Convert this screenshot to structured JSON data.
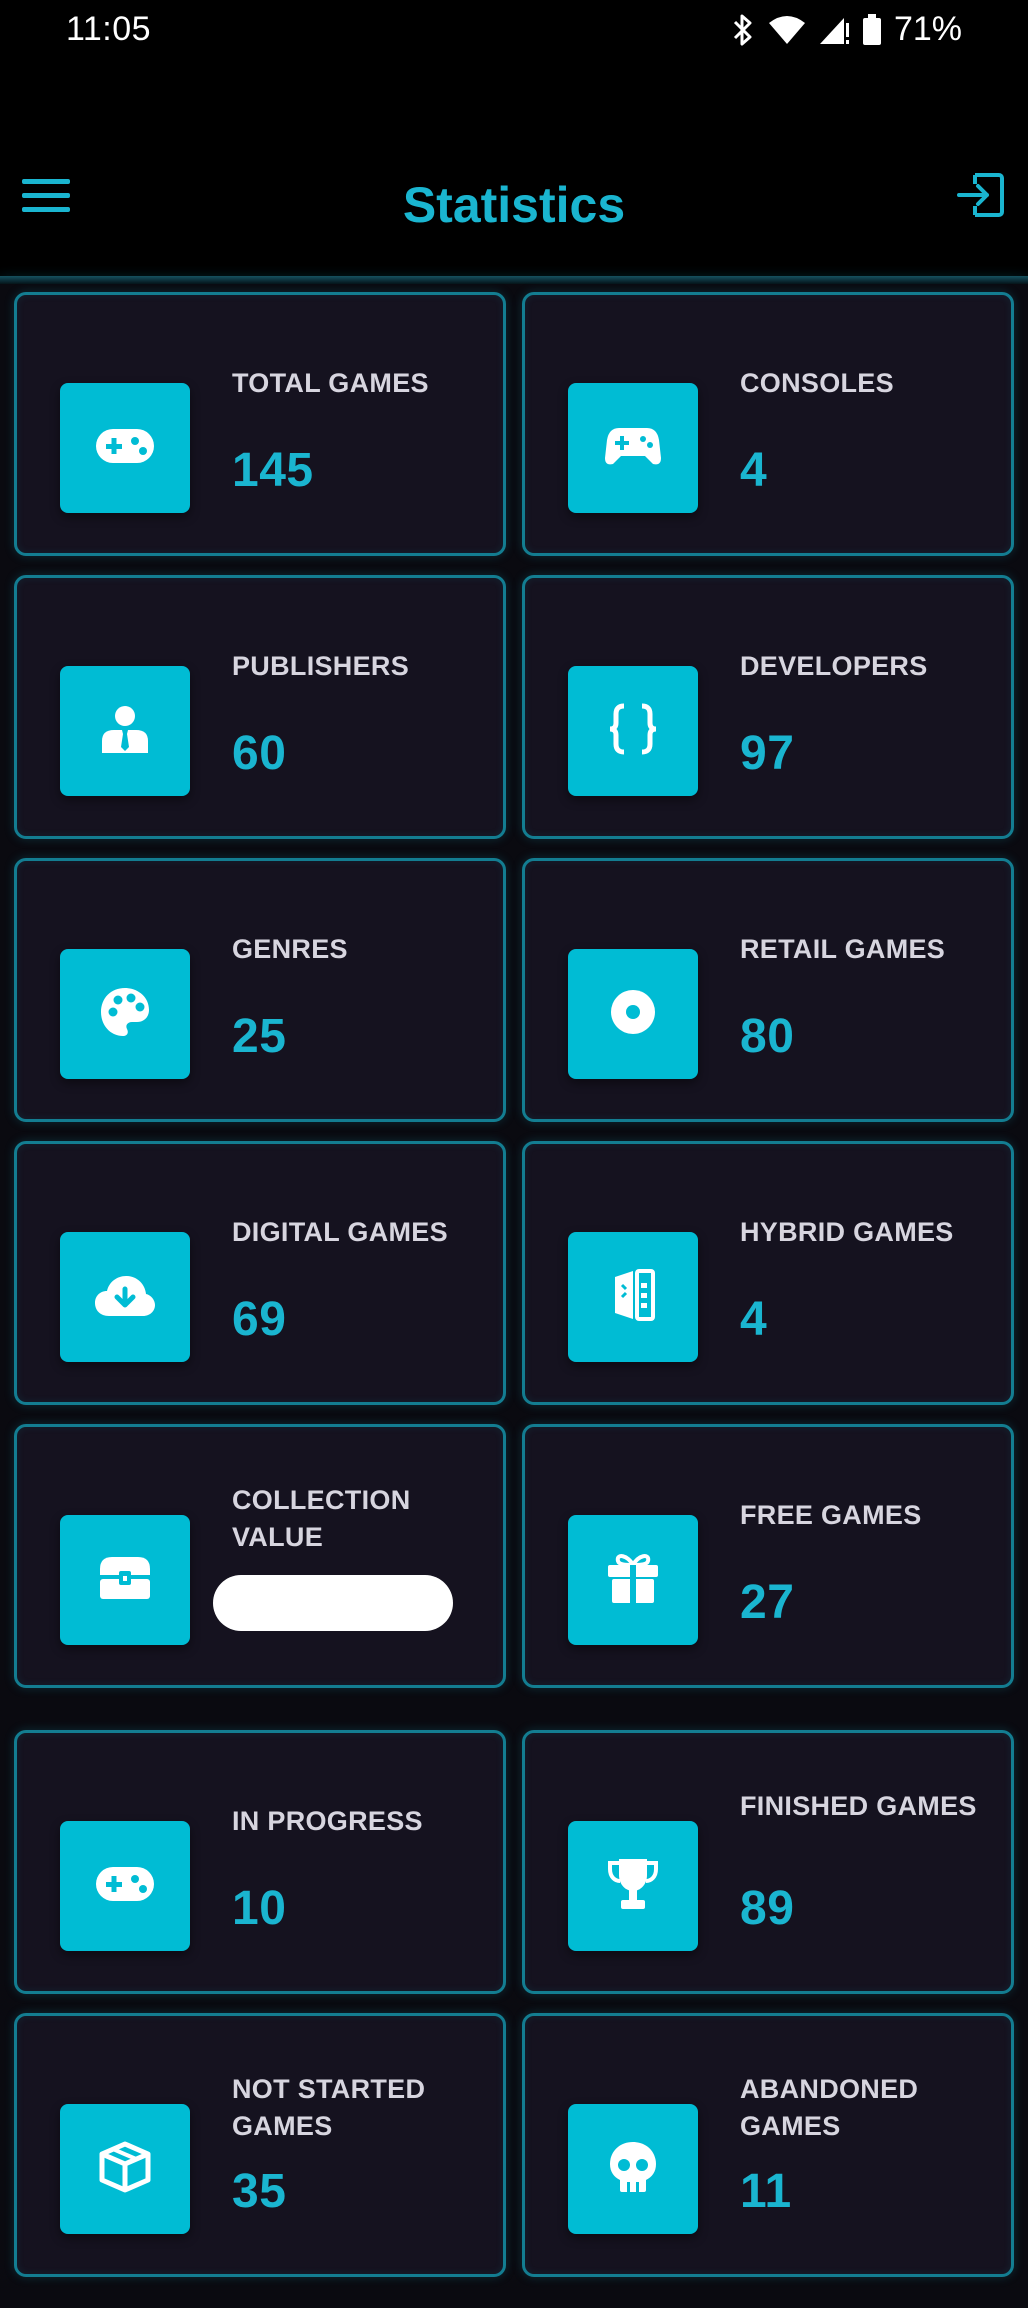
{
  "status_bar": {
    "time": "11:05",
    "battery": "71%",
    "icons": [
      "bluetooth-icon",
      "wifi-icon",
      "signal-icon",
      "battery-icon"
    ]
  },
  "app_bar": {
    "title": "Statistics",
    "menu_icon": "menu-icon",
    "logout_icon": "logout-icon"
  },
  "colors": {
    "accent": "#1ab5d0",
    "icon_box": "#00bcd4",
    "card_border": "#137d91",
    "card_bg": "#15121f",
    "label": "#d7d5df"
  },
  "stats": [
    {
      "label": "TOTAL GAMES",
      "value": "145",
      "icon": "gamepad-icon"
    },
    {
      "label": "CONSOLES",
      "value": "4",
      "icon": "controller-icon"
    },
    {
      "label": "PUBLISHERS",
      "value": "60",
      "icon": "person-tie-icon"
    },
    {
      "label": "DEVELOPERS",
      "value": "97",
      "icon": "code-braces-icon"
    },
    {
      "label": "GENRES",
      "value": "25",
      "icon": "palette-icon"
    },
    {
      "label": "RETAIL GAMES",
      "value": "80",
      "icon": "disc-icon"
    },
    {
      "label": "DIGITAL GAMES",
      "value": "69",
      "icon": "cloud-download-icon"
    },
    {
      "label": "HYBRID GAMES",
      "value": "4",
      "icon": "hybrid-icon"
    },
    {
      "label": "COLLECTION VALUE",
      "value": "",
      "icon": "treasure-chest-icon"
    },
    {
      "label": "FREE GAMES",
      "value": "27",
      "icon": "gift-icon"
    },
    {
      "label": "IN PROGRESS",
      "value": "10",
      "icon": "gamepad-icon"
    },
    {
      "label": "FINISHED GAMES",
      "value": "89",
      "icon": "trophy-icon"
    },
    {
      "label": "NOT STARTED GAMES",
      "value": "35",
      "icon": "box-icon"
    },
    {
      "label": "ABANDONED GAMES",
      "value": "11",
      "icon": "skull-icon"
    }
  ]
}
